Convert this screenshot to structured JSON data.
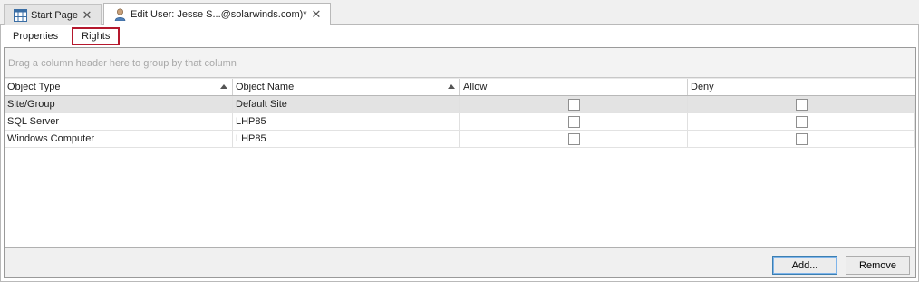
{
  "doc_tabs": [
    {
      "label": "Start Page",
      "icon": "grid-icon"
    },
    {
      "label": "Edit User: Jesse S...@solarwinds.com)*",
      "icon": "user-icon"
    }
  ],
  "sub_tabs": [
    "Properties",
    "Rights"
  ],
  "selected_sub_tab": "Rights",
  "group_hint": "Drag a column header here to group by that column",
  "columns": [
    "Object Type",
    "Object Name",
    "Allow",
    "Deny"
  ],
  "rows": [
    {
      "object_type": "Site/Group",
      "object_name": "Default Site",
      "allow": false,
      "deny": false
    },
    {
      "object_type": "SQL Server",
      "object_name": "LHP85",
      "allow": false,
      "deny": false
    },
    {
      "object_type": "Windows Computer",
      "object_name": "LHP85",
      "allow": false,
      "deny": false
    }
  ],
  "buttons": {
    "add": "Add...",
    "remove": "Remove"
  },
  "colors": {
    "selected_tab_border": "#b5182d",
    "default_button_border": "#3c7fb1"
  }
}
